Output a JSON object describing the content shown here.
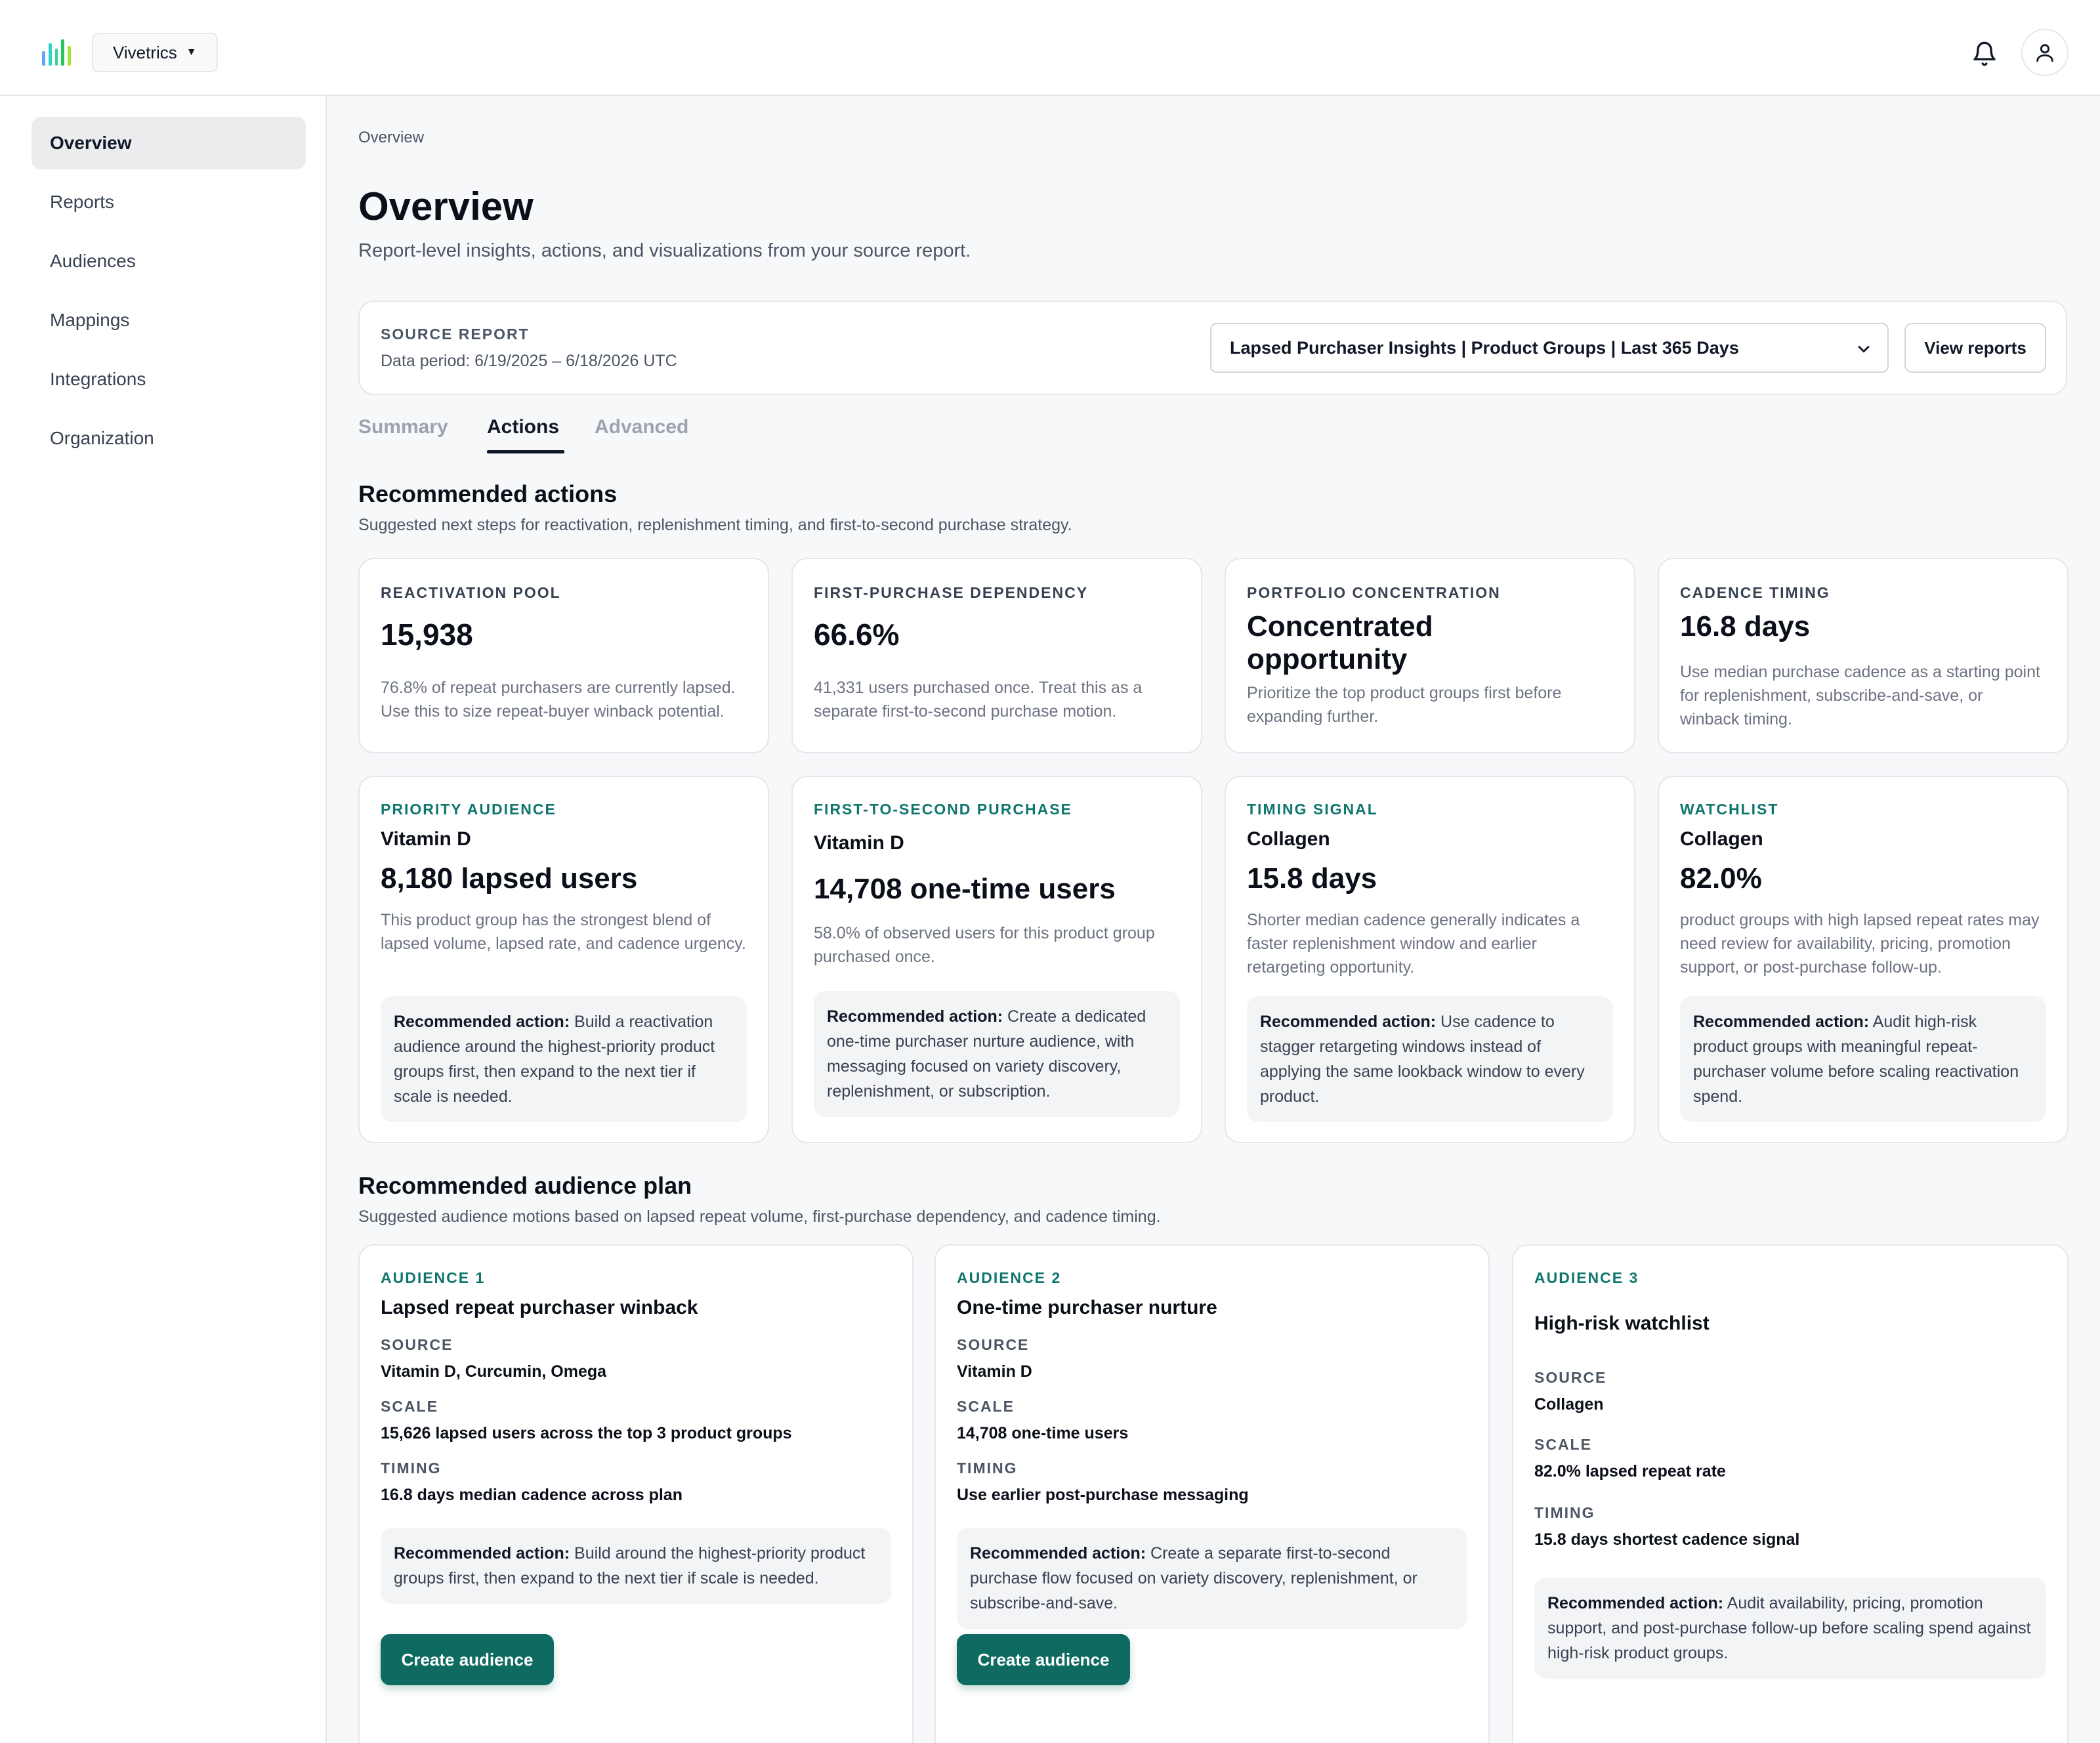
{
  "app": {
    "org_name": "Vivetrics",
    "brand_colors": [
      "#2dd4bf",
      "#34d399",
      "#60a5fa",
      "#a3e635",
      "#22c55e"
    ],
    "accent": "#0f6b62"
  },
  "sidebar": {
    "items": [
      {
        "label": "Overview",
        "active": true
      },
      {
        "label": "Reports"
      },
      {
        "label": "Audiences"
      },
      {
        "label": "Mappings"
      },
      {
        "label": "Integrations"
      },
      {
        "label": "Organization"
      }
    ]
  },
  "header": {
    "breadcrumb": "Overview",
    "title": "Overview",
    "subtitle": "Report-level insights, actions, and visualizations from your source report."
  },
  "source": {
    "label": "SOURCE REPORT",
    "period": "Data period: 6/19/2025 – 6/18/2026 UTC",
    "selected_report": "Lapsed Purchaser Insights | Product Groups | Last 365 Days",
    "view_button": "View reports"
  },
  "tabs": [
    {
      "label": "Summary"
    },
    {
      "label": "Actions",
      "active": true
    },
    {
      "label": "Advanced"
    }
  ],
  "recommended": {
    "title": "Recommended actions",
    "subtitle": "Suggested next steps for reactivation, replenishment timing, and first-to-second purchase strategy.",
    "metrics": [
      {
        "label": "REACTIVATION POOL",
        "value": "15,938",
        "desc": "76.8% of repeat purchasers are currently lapsed. Use this to size repeat-buyer winback potential."
      },
      {
        "label": "FIRST-PURCHASE DEPENDENCY",
        "value": "66.6%",
        "desc": "41,331 users purchased once. Treat this as a separate first-to-second purchase motion."
      },
      {
        "label": "PORTFOLIO CONCENTRATION",
        "value": "Concentrated opportunity",
        "desc": "Prioritize the top product groups first before expanding further."
      },
      {
        "label": "CADENCE TIMING",
        "value": "16.8 days",
        "desc": "Use median purchase cadence as a starting point for replenishment, subscribe-and-save, or winback timing."
      }
    ],
    "insights": [
      {
        "label": "PRIORITY AUDIENCE",
        "entity": "Vitamin D",
        "value": "8,180 lapsed users",
        "desc": "This product group has the strongest blend of lapsed volume, lapsed rate, and cadence urgency.",
        "rec_label": "Recommended action:",
        "rec_text": " Build a reactivation audience around the highest-priority product groups first, then expand to the next tier if scale is needed."
      },
      {
        "label": "FIRST-TO-SECOND PURCHASE",
        "entity": "Vitamin D",
        "value": "14,708 one-time users",
        "desc": "58.0% of observed users for this product group purchased once.",
        "rec_label": "Recommended action:",
        "rec_text": " Create a dedicated one-time purchaser nurture audience, with messaging focused on variety discovery, replenishment, or subscription."
      },
      {
        "label": "TIMING SIGNAL",
        "entity": "Collagen",
        "value": "15.8 days",
        "desc": "Shorter median cadence generally indicates a faster replenishment window and earlier retargeting opportunity.",
        "rec_label": "Recommended action:",
        "rec_text": " Use cadence to stagger retargeting windows instead of applying the same lookback window to every product."
      },
      {
        "label": "WATCHLIST",
        "entity": "Collagen",
        "value": "82.0%",
        "desc": "product groups with high lapsed repeat rates may need review for availability, pricing, promotion support, or post-purchase follow-up.",
        "rec_label": "Recommended action:",
        "rec_text": " Audit high-risk product groups with meaningful repeat-purchaser volume before scaling reactivation spend."
      }
    ]
  },
  "plan": {
    "title": "Recommended audience plan",
    "subtitle": "Suggested audience motions based on lapsed repeat volume, first-purchase dependency, and cadence timing.",
    "source_key": "SOURCE",
    "scale_key": "SCALE",
    "timing_key": "TIMING",
    "audiences": [
      {
        "label": "AUDIENCE 1",
        "title": "Lapsed repeat purchaser winback",
        "source": "Vitamin D, Curcumin, Omega",
        "scale": "15,626 lapsed users across the top 3 product groups",
        "timing": "16.8 days median cadence across plan",
        "rec_label": "Recommended action:",
        "rec_text": " Build around the highest-priority product groups first, then expand to the next tier if scale is needed.",
        "button": "Create audience"
      },
      {
        "label": "AUDIENCE 2",
        "title": "One-time purchaser nurture",
        "source": "Vitamin D",
        "scale": "14,708 one-time users",
        "timing": "Use earlier post-purchase messaging",
        "rec_label": "Recommended action:",
        "rec_text": " Create a separate first-to-second purchase flow focused on variety discovery, replenishment, or subscribe-and-save.",
        "button": "Create audience"
      },
      {
        "label": "AUDIENCE 3",
        "title": "High-risk watchlist",
        "source": "Collagen",
        "scale": "82.0% lapsed repeat rate",
        "timing": "15.8 days shortest cadence signal",
        "rec_label": "Recommended action:",
        "rec_text": " Audit availability, pricing, promotion support, and post-purchase follow-up before scaling spend against high-risk product groups."
      }
    ]
  }
}
